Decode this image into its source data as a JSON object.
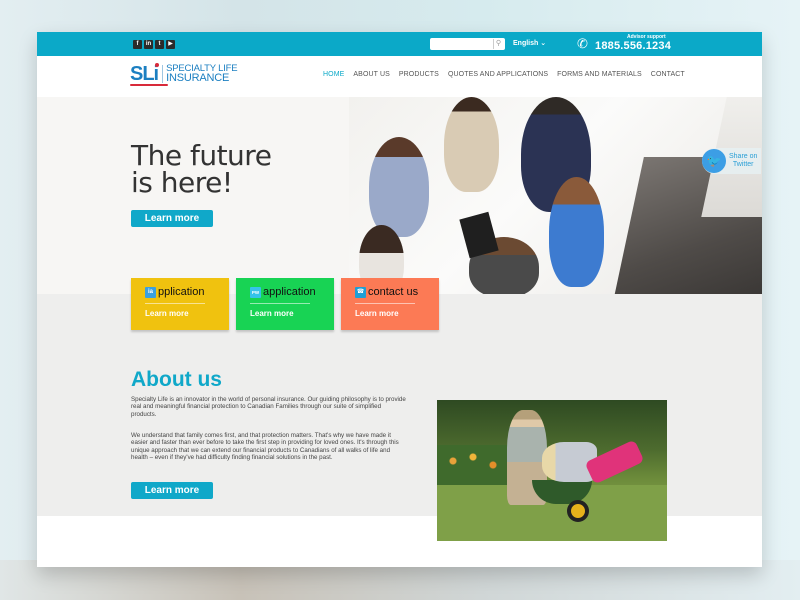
{
  "topbar": {
    "social": [
      {
        "name": "facebook",
        "glyph": "f"
      },
      {
        "name": "linkedin",
        "glyph": "in"
      },
      {
        "name": "twitter",
        "glyph": "t"
      },
      {
        "name": "youtube",
        "glyph": "▶"
      }
    ],
    "search": {
      "placeholder": "",
      "value": ""
    },
    "language": "English ⌄",
    "advisor_label": "Advisor support",
    "phone": "1885.556.1234"
  },
  "header": {
    "logo_mark": "SLi",
    "logo_line1": "SPECIALTY LIFE",
    "logo_line2": "INSURANCE",
    "nav": [
      {
        "label": "HOME",
        "active": true
      },
      {
        "label": "ABOUT US",
        "active": false
      },
      {
        "label": "PRODUCTS",
        "active": false
      },
      {
        "label": "QUOTES AND APPLICATIONS",
        "active": false
      },
      {
        "label": "FORMS  AND MATERIALS",
        "active": false
      },
      {
        "label": "CONTACT",
        "active": false
      }
    ]
  },
  "hero": {
    "title_line1": "The future",
    "title_line2": "is here!",
    "button": "Learn more",
    "twitter_share": {
      "line1": "Share on",
      "line2": "Twitter"
    }
  },
  "cards": [
    {
      "icon_text": "ia",
      "title": "pplication",
      "link": "Learn more",
      "color": "#f0c20f",
      "icon_color": "#3aa0e0"
    },
    {
      "icon_text": "PW",
      "title": "application",
      "link": "Learn more",
      "color": "#18d354",
      "icon_color": "#35c3ea"
    },
    {
      "icon_text": "☎",
      "title": "contact us",
      "link": "Learn more",
      "color": "#fc7a55",
      "icon_color": "#1d9fd6"
    }
  ],
  "about": {
    "title": "About us",
    "paragraph1": "Specialty Life is an innovator in the world of personal insurance. Our guiding philosophy is to provide real and meaningful financial protection to Canadian Families through our suite of simplified products.",
    "paragraph2": "We understand that family comes first, and that protection matters. That's why we have made it easier and faster than ever before to take the first step in providing for loved ones. It's through this unique approach that we can extend our financial products to Canadians of all walks of life and health – even if they've had difficulty finding financial solutions in the past.",
    "button": "Learn more"
  },
  "colors": {
    "brand": "#0ba9c8",
    "logo_blue": "#1b7fc1",
    "logo_red": "#d82a3a"
  }
}
